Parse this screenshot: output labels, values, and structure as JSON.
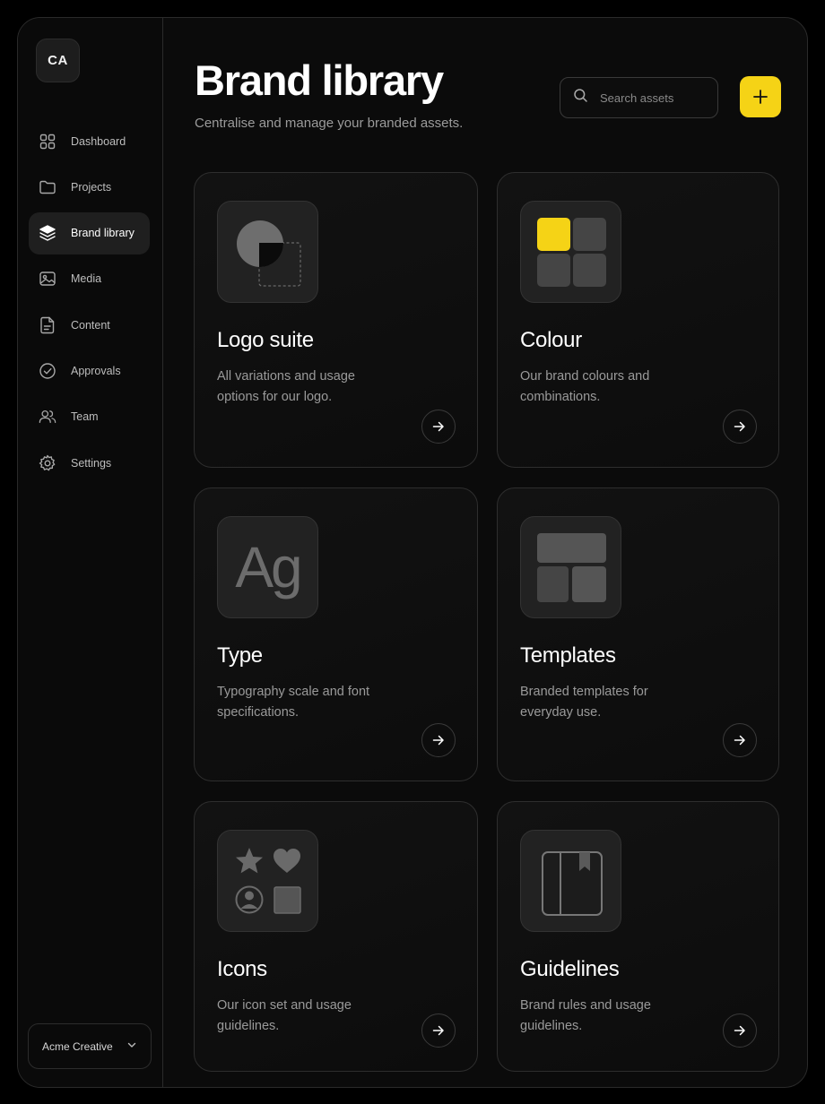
{
  "sidebar": {
    "avatar_initials": "CA",
    "items": [
      {
        "label": "Dashboard",
        "icon": "grid-icon"
      },
      {
        "label": "Projects",
        "icon": "folder-icon"
      },
      {
        "label": "Brand library",
        "icon": "layers-icon",
        "active": true
      },
      {
        "label": "Media",
        "icon": "image-icon"
      },
      {
        "label": "Content",
        "icon": "document-icon"
      },
      {
        "label": "Approvals",
        "icon": "check-circle-icon"
      },
      {
        "label": "Team",
        "icon": "users-icon"
      },
      {
        "label": "Settings",
        "icon": "gear-icon"
      }
    ],
    "workspace": "Acme Creative"
  },
  "header": {
    "title": "Brand library",
    "subtitle": "Centralise and manage your branded assets.",
    "search_placeholder": "Search assets",
    "add_button": "+"
  },
  "cards": [
    {
      "title": "Logo suite",
      "description": "All variations and usage options for our logo.",
      "icon": "logo-icon"
    },
    {
      "title": "Colour",
      "description": "Our brand colours and combinations.",
      "icon": "colour-swatch-icon"
    },
    {
      "title": "Type",
      "description": "Typography scale and font specifications.",
      "icon": "type-icon",
      "glyph": "Ag"
    },
    {
      "title": "Templates",
      "description": "Branded templates for everyday use.",
      "icon": "template-layout-icon"
    },
    {
      "title": "Icons",
      "description": "Our icon set and usage guidelines.",
      "icon": "icon-set-icon"
    },
    {
      "title": "Guidelines",
      "description": "Brand rules and usage guidelines.",
      "icon": "book-icon"
    }
  ],
  "colors": {
    "accent": "#f5d316",
    "background": "#0b0b0b",
    "border": "#2e2e2e"
  }
}
